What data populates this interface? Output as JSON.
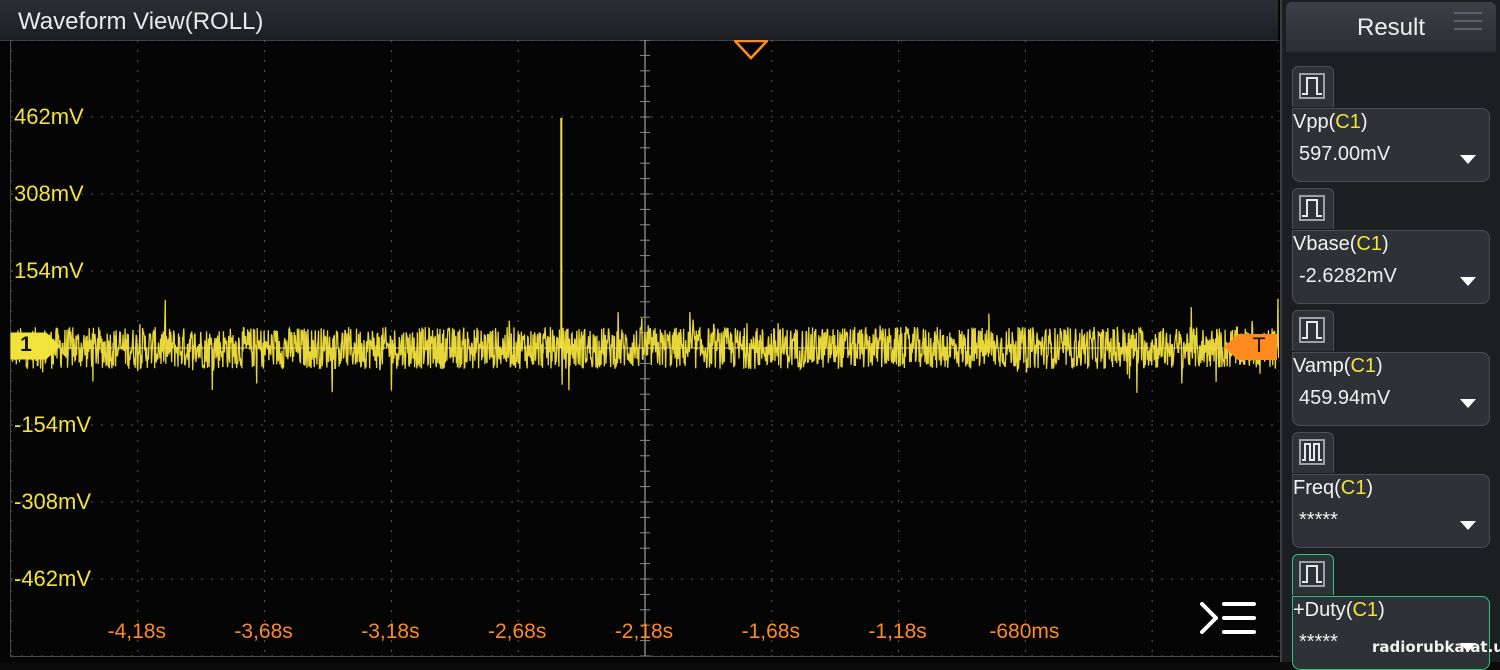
{
  "title": "Waveform View(ROLL)",
  "channel_marker": "1",
  "trigger_marker": "T",
  "colors": {
    "trace": "#f2e23c",
    "time_labels": "#ff8a1e",
    "trigger": "#ff8a1e",
    "accent_active": "#2ec47a"
  },
  "waveform": {
    "noise_band_mv": 60,
    "spike_time_s": -2.51,
    "spike_peak_mv": 459.94
  },
  "chart_data": {
    "type": "line",
    "xlim": [
      -4.68,
      0.32
    ],
    "ylim": [
      -616,
      616
    ],
    "y_ticks": [
      {
        "value": 462,
        "label": "462mV"
      },
      {
        "value": 308,
        "label": "308mV"
      },
      {
        "value": 154,
        "label": "154mV"
      },
      {
        "value": -154,
        "label": "-154mV"
      },
      {
        "value": -308,
        "label": "-308mV"
      },
      {
        "value": -462,
        "label": "-462mV"
      }
    ],
    "x_ticks": [
      {
        "value": -4.18,
        "label": "-4,18s"
      },
      {
        "value": -3.68,
        "label": "-3,68s"
      },
      {
        "value": -3.18,
        "label": "-3,18s"
      },
      {
        "value": -2.68,
        "label": "-2,68s"
      },
      {
        "value": -2.18,
        "label": "-2,18s"
      },
      {
        "value": -1.68,
        "label": "-1,68s"
      },
      {
        "value": -1.18,
        "label": "-1,18s"
      },
      {
        "value": -0.68,
        "label": "-680ms"
      }
    ],
    "grid": true
  },
  "result_panel": {
    "title": "Result",
    "measurements": [
      {
        "name": "Vpp",
        "source": "C1",
        "value": "597.00mV",
        "icon": "pulse-icon"
      },
      {
        "name": "Vbase",
        "source": "C1",
        "value": "-2.6282mV",
        "icon": "pulse-icon"
      },
      {
        "name": "Vamp",
        "source": "C1",
        "value": "459.94mV",
        "icon": "pulse-icon"
      },
      {
        "name": "Freq",
        "source": "C1",
        "value": "*****",
        "icon": "pulse-train-icon"
      },
      {
        "name": "+Duty",
        "source": "C1",
        "value": "*****",
        "icon": "pulse-icon"
      }
    ]
  },
  "watermark": "radiorubka.at.ua"
}
